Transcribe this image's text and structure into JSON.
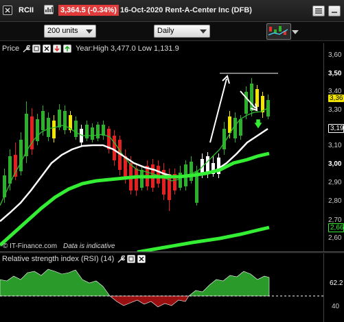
{
  "header": {
    "symbol": "RCII",
    "price_change": "3,364.5 (-0.34%)",
    "date_company": "16-Oct-2020 Rent-A-Center Inc (DFB)"
  },
  "toolbar": {
    "units": "200 units",
    "period": "Daily"
  },
  "price_pane": {
    "label": "Price",
    "range_text": "Year:High 3,477.0 Low 1,131.9",
    "axis_ticks": [
      "3,60",
      "3,50",
      "3,40",
      "3,30",
      "3,19",
      "3,10",
      "3,00",
      "2,90",
      "2,80",
      "2,70",
      "2,66",
      "2,60"
    ],
    "last_price_tag": "3,36",
    "ma_tag": "3,19",
    "long_ma_tag": "2,66",
    "watermark": "© IT-Finance.com",
    "indicative": "Data is indicative"
  },
  "rsi_pane": {
    "label": "Relative strength index (RSI) (14)",
    "value_tag": "62.2",
    "level_tick": "40"
  },
  "colors": {
    "up_candle": "#2db12d",
    "down_candle": "#e62020",
    "neutral_candle": "#ffffff",
    "highlight_candle": "#f2e600",
    "ma_fast": "#2fbf2f",
    "ma_white": "#ffffff",
    "ma_long": "#33ee33",
    "price_tag": "#f2e600",
    "change_badge": "#e23b3b"
  }
}
